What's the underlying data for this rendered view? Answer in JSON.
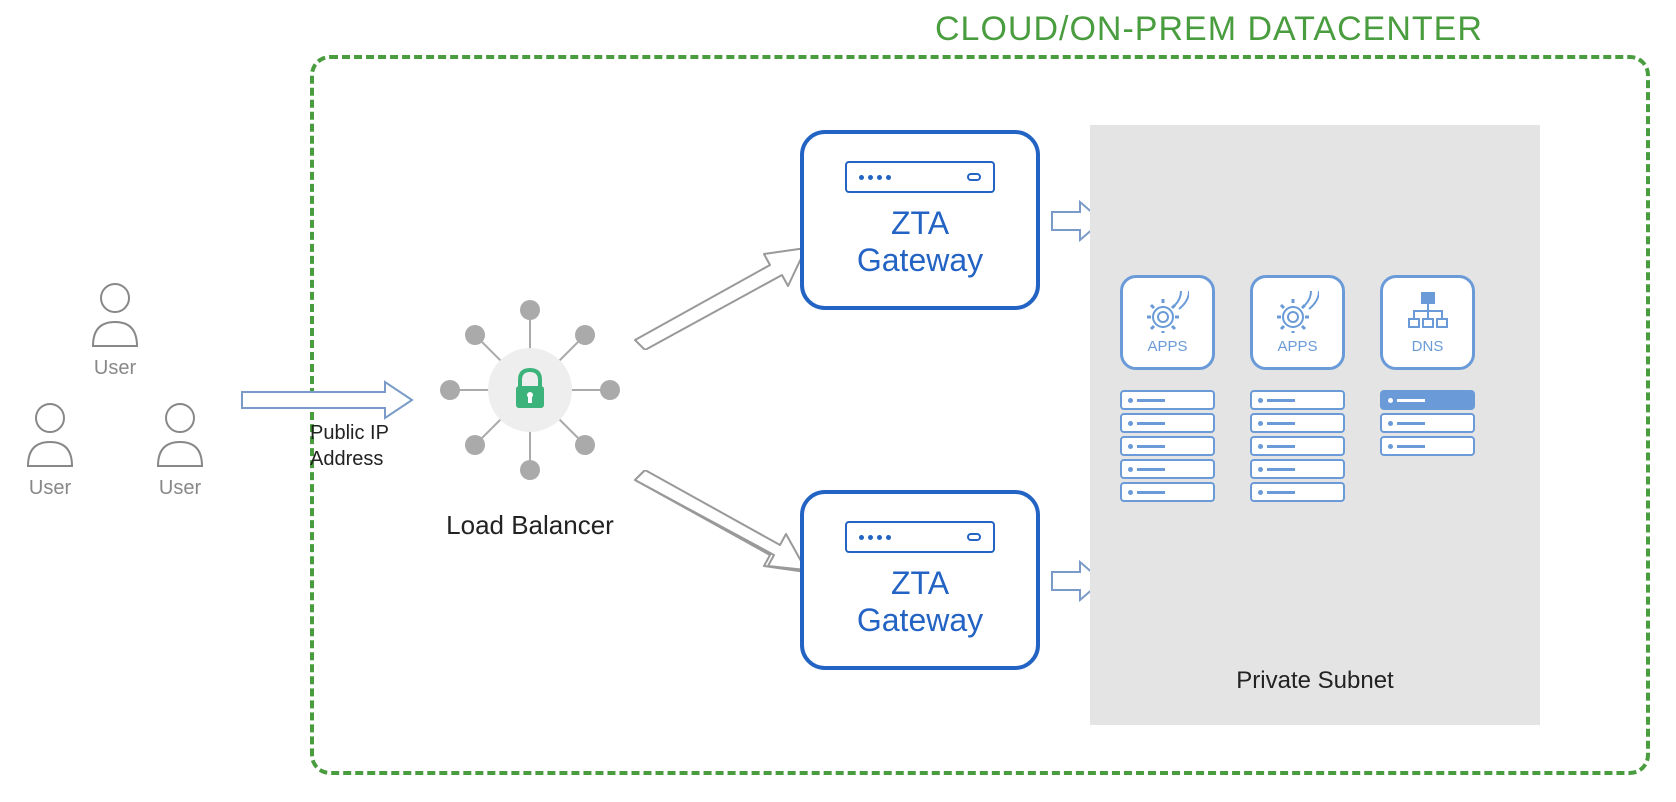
{
  "datacenter": {
    "title": "CLOUD/ON-PREM DATACENTER"
  },
  "users": {
    "label": "User"
  },
  "publicIp": {
    "line1": "Public IP",
    "line2": "Address"
  },
  "loadBalancer": {
    "label": "Load Balancer"
  },
  "gateway": {
    "line1": "ZTA",
    "line2": "Gateway"
  },
  "subnet": {
    "label": "Private Subnet",
    "apps": "APPS",
    "dns": "DNS"
  }
}
